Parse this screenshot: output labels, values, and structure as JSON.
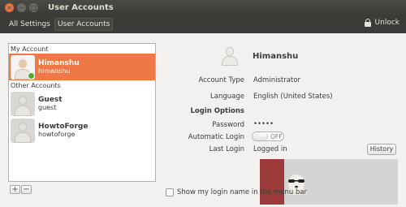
{
  "window": {
    "title": "User Accounts",
    "buttons": [
      "close-icon",
      "minimize-icon",
      "maximize-icon"
    ]
  },
  "toolbar": {
    "breadcrumbs": [
      "All Settings",
      "User Accounts"
    ],
    "unlock_label": "Unlock"
  },
  "accounts": {
    "my_section": "My Account",
    "other_section": "Other Accounts",
    "items": [
      {
        "name": "Himanshu",
        "username": "himanshu",
        "selected": true
      },
      {
        "name": "Guest",
        "username": "guest",
        "selected": false
      },
      {
        "name": "HowtoForge",
        "username": "howtoforge",
        "selected": false
      }
    ],
    "add_label": "+",
    "remove_label": "−"
  },
  "details": {
    "name": "Himanshu",
    "account_type_label": "Account Type",
    "account_type": "Administrator",
    "language_label": "Language",
    "language": "English (United States)",
    "login_options_label": "Login Options",
    "password_label": "Password",
    "password": "•••••",
    "auto_login_label": "Automatic Login",
    "auto_login_state": "OFF",
    "last_login_label": "Last Login",
    "last_login": "Logged in",
    "history_button": "History",
    "menubar_checkbox_label": "Show my login name in the menu bar"
  },
  "colors": {
    "accent": "#ef7847",
    "titlebar": "#3c3b37",
    "background": "#f2f1f0"
  }
}
